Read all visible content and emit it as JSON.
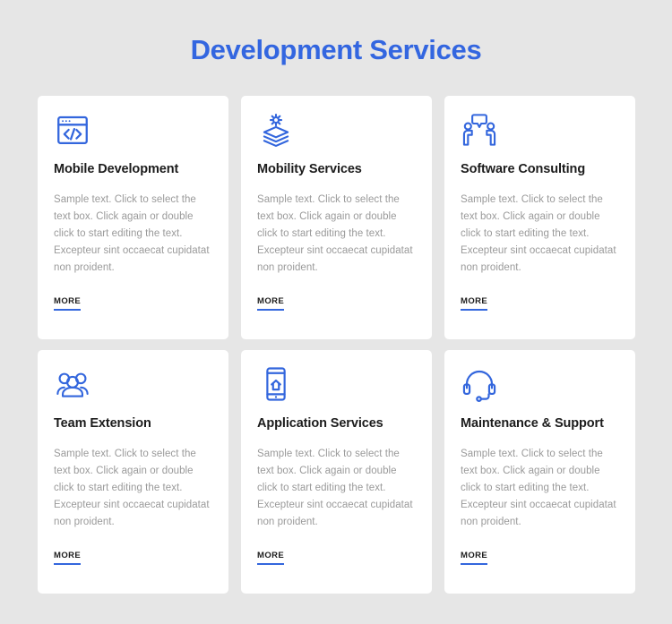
{
  "header": {
    "title": "Development Services",
    "title_color": "#3366e0"
  },
  "theme": {
    "page_background": "#e6e6e6",
    "card_background": "#ffffff",
    "accent_blue": "#3366dd",
    "body_text_color": "#9a9a9a",
    "title_text_color": "#1c1c1c"
  },
  "cards": [
    {
      "icon": "code-window-icon",
      "title": "Mobile Development",
      "body": "Sample text. Click to select the text box. Click again or double click to start editing the text. Excepteur sint occaecat cupidatat non proident.",
      "more_label": "MORE"
    },
    {
      "icon": "gear-layers-icon",
      "title": "Mobility Services",
      "body": "Sample text. Click to select the text box. Click again or double click to start editing the text. Excepteur sint occaecat cupidatat non proident.",
      "more_label": "MORE"
    },
    {
      "icon": "people-speech-bubble-icon",
      "title": "Software Consulting",
      "body": "Sample text. Click to select the text box. Click again or double click to start editing the text. Excepteur sint occaecat cupidatat non proident.",
      "more_label": "MORE"
    },
    {
      "icon": "group-people-icon",
      "title": "Team Extension",
      "body": "Sample text. Click to select the text box. Click again or double click to start editing the text. Excepteur sint occaecat cupidatat non proident.",
      "more_label": "MORE"
    },
    {
      "icon": "smartphone-home-icon",
      "title": "Application Services",
      "body": "Sample text. Click to select the text box. Click again or double click to start editing the text. Excepteur sint occaecat cupidatat non proident.",
      "more_label": "MORE"
    },
    {
      "icon": "headset-support-icon",
      "title": "Maintenance & Support",
      "body": "Sample text. Click to select the text box. Click again or double click to start editing the text. Excepteur sint occaecat cupidatat non proident.",
      "more_label": "MORE"
    }
  ]
}
